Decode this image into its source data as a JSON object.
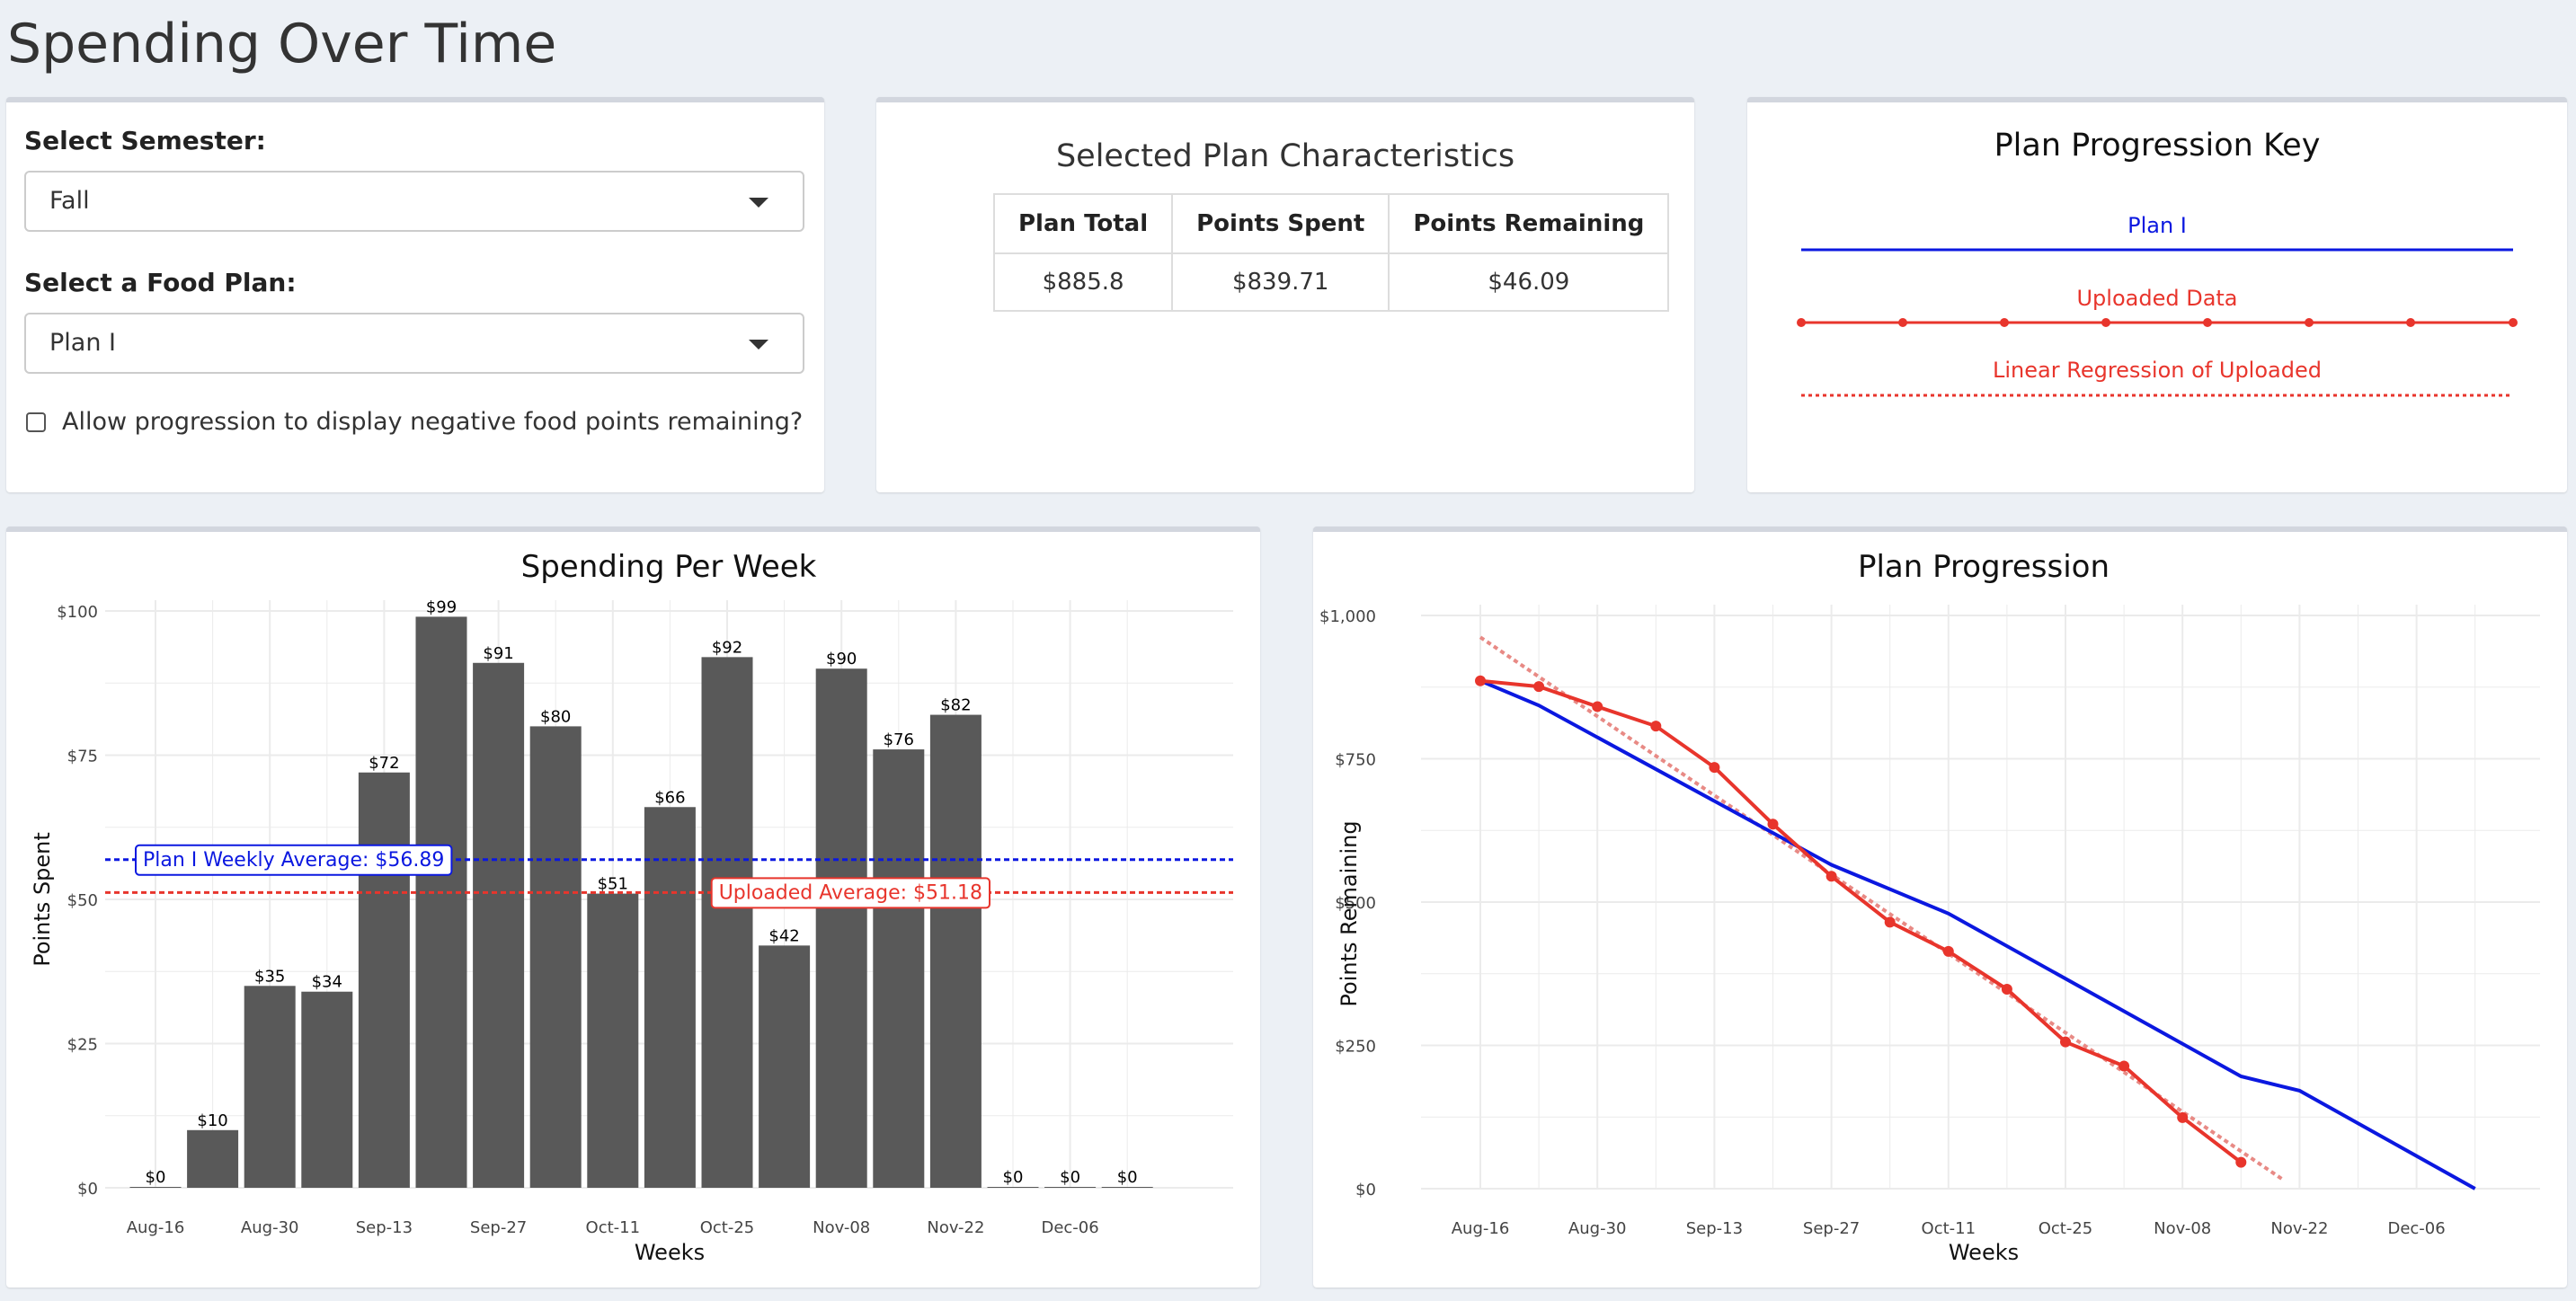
{
  "page": {
    "title": "Spending Over Time"
  },
  "controls": {
    "semester_label": "Select Semester:",
    "semester_value": "Fall",
    "plan_label": "Select a Food Plan:",
    "plan_value": "Plan I",
    "negative_label": "Allow progression to display negative food points remaining?",
    "negative_checked": false
  },
  "characteristics": {
    "title": "Selected Plan Characteristics",
    "headers": [
      "Plan Total",
      "Points Spent",
      "Points Remaining"
    ],
    "values": [
      "$885.8",
      "$839.71",
      "$46.09"
    ]
  },
  "key": {
    "title": "Plan Progression Key",
    "items": [
      {
        "label": "Plan I",
        "color": "#0b18e0",
        "style": "solid"
      },
      {
        "label": "Uploaded Data",
        "color": "#e8352c",
        "style": "solid-points"
      },
      {
        "label": "Linear Regression of Uploaded",
        "color": "#e8352c",
        "style": "dotted"
      }
    ]
  },
  "colors": {
    "plan": "#0b18e0",
    "uploaded": "#e8352c",
    "regression": "#e88a85",
    "bar": "#595959",
    "grid": "#ebebeb"
  },
  "chart_data": [
    {
      "type": "bar",
      "title": "Spending Per Week",
      "xlabel": "Weeks",
      "ylabel": "Points Spent",
      "ylim": [
        0,
        100
      ],
      "yticks": [
        "$0",
        "$25",
        "$50",
        "$75",
        "$100"
      ],
      "xticks": [
        "Aug-16",
        "Aug-30",
        "Sep-13",
        "Sep-27",
        "Oct-11",
        "Oct-25",
        "Nov-08",
        "Nov-22",
        "Dec-06"
      ],
      "categories": [
        "Aug-16",
        "Aug-23",
        "Aug-30",
        "Sep-06",
        "Sep-13",
        "Sep-20",
        "Sep-27",
        "Oct-04",
        "Oct-11",
        "Oct-18",
        "Oct-25",
        "Nov-01",
        "Nov-08",
        "Nov-15",
        "Nov-22",
        "Nov-29",
        "Dec-06",
        "Dec-13"
      ],
      "values": [
        0,
        10,
        35,
        34,
        72,
        99,
        91,
        80,
        51,
        66,
        92,
        42,
        90,
        76,
        82,
        0,
        0,
        0
      ],
      "value_labels": [
        "$0",
        "$10",
        "$35",
        "$34",
        "$72",
        "$99",
        "$91",
        "$80",
        "$51",
        "$66",
        "$92",
        "$42",
        "$90",
        "$76",
        "$82",
        "$0",
        "$0",
        "$0"
      ],
      "reference_lines": [
        {
          "label": "Plan I Weekly Average: $56.89",
          "value": 56.89,
          "color": "#0b18e0"
        },
        {
          "label": "Uploaded Average: $51.18",
          "value": 51.18,
          "color": "#e8352c"
        }
      ],
      "grid": true
    },
    {
      "type": "line",
      "title": "Plan Progression",
      "xlabel": "Weeks",
      "ylabel": "Points Remaining",
      "ylim": [
        0,
        1000
      ],
      "yticks": [
        "$0",
        "$250",
        "$500",
        "$750",
        "$1,000"
      ],
      "xticks": [
        "Aug-16",
        "Aug-30",
        "Sep-13",
        "Sep-27",
        "Oct-11",
        "Oct-25",
        "Nov-08",
        "Nov-22",
        "Dec-06"
      ],
      "x_start": "Aug-16",
      "series": [
        {
          "name": "Plan I",
          "points": [
            [
              "2021-08-16",
              886
            ],
            [
              "2021-08-23",
              843
            ],
            [
              "2021-09-27",
              565
            ],
            [
              "2021-10-11",
              480
            ],
            [
              "2021-11-15",
              196
            ],
            [
              "2021-11-22",
              171
            ],
            [
              "2021-12-13",
              0
            ]
          ]
        },
        {
          "name": "Uploaded Data",
          "points": [
            [
              "2021-08-16",
              886
            ],
            [
              "2021-08-23",
              876
            ],
            [
              "2021-08-30",
              841
            ],
            [
              "2021-09-06",
              807
            ],
            [
              "2021-09-13",
              735
            ],
            [
              "2021-09-20",
              636
            ],
            [
              "2021-09-27",
              545
            ],
            [
              "2021-10-04",
              465
            ],
            [
              "2021-10-11",
              414
            ],
            [
              "2021-10-18",
              348
            ],
            [
              "2021-10-25",
              256
            ],
            [
              "2021-11-01",
              214
            ],
            [
              "2021-11-08",
              124
            ],
            [
              "2021-11-15",
              46
            ]
          ]
        },
        {
          "name": "Linear Regression of Uploaded",
          "points": [
            [
              "2021-08-16",
              962
            ],
            [
              "2021-11-20",
              16
            ]
          ]
        }
      ],
      "grid": true
    }
  ]
}
